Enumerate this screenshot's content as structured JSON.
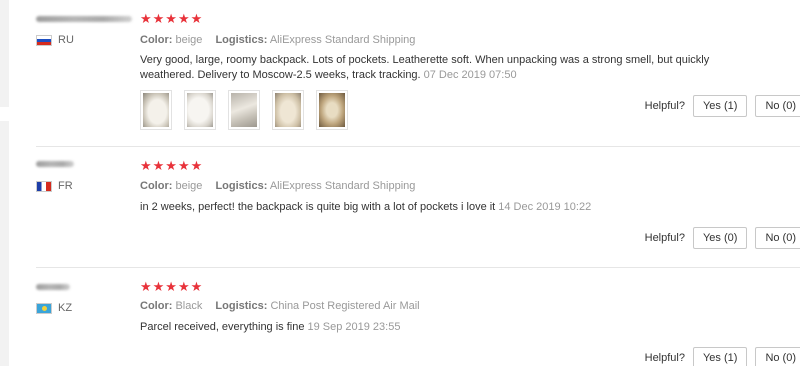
{
  "reviews": [
    {
      "country": "RU",
      "flag": "ru-flag-icon",
      "rating": 5,
      "stars": "★★★★★",
      "color_label": "Color:",
      "color_value": "beige",
      "logistics_label": "Logistics:",
      "logistics_value": "AliExpress Standard Shipping",
      "text": "Very good, large, roomy backpack. Lots of pockets. Leatherette soft. When unpacking was a strong smell, but quickly weathered. Delivery to Moscow-2.5 weeks, track tracking.",
      "date": "07 Dec 2019 07:50",
      "photos": 5,
      "helpful_label": "Helpful?",
      "yes_label": "Yes (1)",
      "no_label": "No (0)"
    },
    {
      "country": "FR",
      "flag": "fr-flag-icon",
      "rating": 5,
      "stars": "★★★★★",
      "color_label": "Color:",
      "color_value": "beige",
      "logistics_label": "Logistics:",
      "logistics_value": "AliExpress Standard Shipping",
      "text": "in 2 weeks, perfect! the backpack is quite big with a lot of pockets i love it",
      "date": "14 Dec 2019 10:22",
      "helpful_label": "Helpful?",
      "yes_label": "Yes (0)",
      "no_label": "No (0)"
    },
    {
      "country": "KZ",
      "flag": "kz-flag-icon",
      "rating": 5,
      "stars": "★★★★★",
      "color_label": "Color:",
      "color_value": "Black",
      "logistics_label": "Logistics:",
      "logistics_value": "China Post Registered Air Mail",
      "text": "Parcel received, everything is fine",
      "date": "19 Sep 2019 23:55",
      "helpful_label": "Helpful?",
      "yes_label": "Yes (1)",
      "no_label": "No (0)"
    }
  ],
  "colors": {
    "star": "#e8323a",
    "meta": "#999999",
    "divider": "#e6e6e6"
  }
}
